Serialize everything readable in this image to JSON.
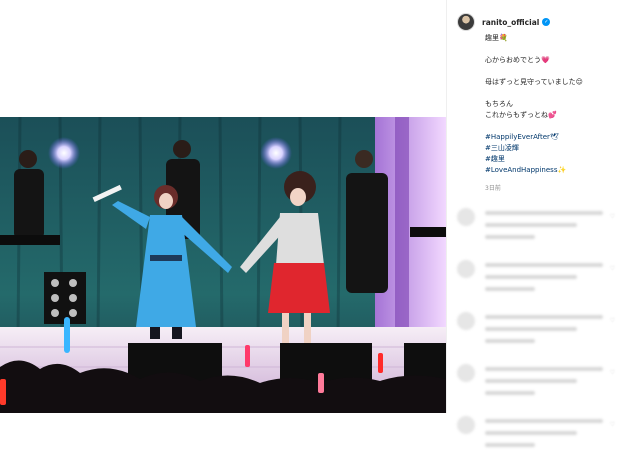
{
  "post": {
    "username": "ranito_official",
    "verified_mark": "✓",
    "caption": [
      {
        "type": "text",
        "text": "趣里",
        "emoji": "💐"
      },
      {
        "type": "gap"
      },
      {
        "type": "text",
        "text": "心からおめでとう",
        "emoji": "💗"
      },
      {
        "type": "gap"
      },
      {
        "type": "text",
        "text": "母はずっと見守っていました",
        "emoji": "😌"
      },
      {
        "type": "gap"
      },
      {
        "type": "text",
        "text": "もちろん",
        "emoji": ""
      },
      {
        "type": "text",
        "text": "これからもずっとね",
        "emoji": "💕"
      },
      {
        "type": "gap"
      },
      {
        "type": "hashtag",
        "text": "#HappilyEverAfter",
        "emoji": "🕊"
      },
      {
        "type": "hashtag",
        "text": "#三山凌輝",
        "emoji": ""
      },
      {
        "type": "hashtag",
        "text": "#趣里",
        "emoji": ""
      },
      {
        "type": "hashtag",
        "text": "#LoveAndHappiness",
        "emoji": "✨"
      }
    ],
    "time_ago": "3日前"
  },
  "comments_count_visible": 5,
  "colors": {
    "stage_curtain": "#1d5a5e",
    "stage_floor": "#efe6ef",
    "dress_blue": "#3fa9e6",
    "skirt_red": "#e0262e",
    "hashtag": "#00376b",
    "verified": "#0095f6"
  },
  "icons": {
    "verified": "verified-badge-icon",
    "heart": "heart-icon"
  }
}
